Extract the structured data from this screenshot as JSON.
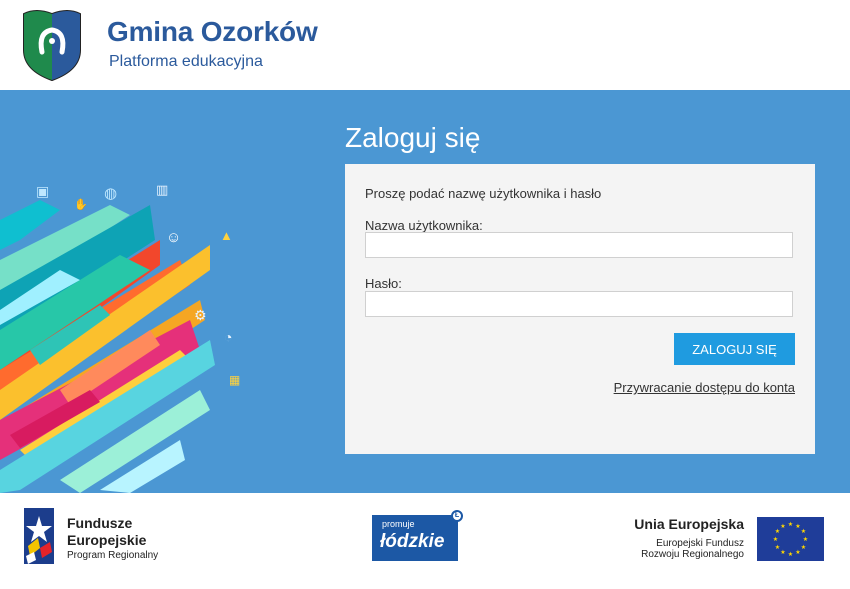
{
  "header": {
    "title": "Gmina Ozorków",
    "subtitle": "Platforma edukacyjna",
    "crest_icon": "coat-of-arms-horseshoe",
    "brand_color": "#2b5a9c"
  },
  "hero": {
    "background_color": "#4b97d3",
    "login_title": "Zaloguj się"
  },
  "login_form": {
    "prompt": "Proszę podać nazwę użytkownika i hasło",
    "username_label": "Nazwa użytkownika:",
    "username_value": "",
    "password_label": "Hasło:",
    "password_value": "",
    "submit_label": "ZALOGUJ SIĘ",
    "recover_link": "Przywracanie dostępu do konta",
    "button_color": "#1f9be0"
  },
  "footer": {
    "fe": {
      "line1": "Fundusze",
      "line2": "Europejskie",
      "line3": "Program Regionalny",
      "icon": "eu-funds-star-icon"
    },
    "lodzkie": {
      "top": "promuje",
      "name": "łódzkie",
      "badge": "Ł"
    },
    "eu": {
      "line1": "Unia Europejska",
      "line2": "Europejski Fundusz",
      "line3": "Rozwoju Regionalnego",
      "flag_icon": "eu-flag-icon"
    }
  }
}
